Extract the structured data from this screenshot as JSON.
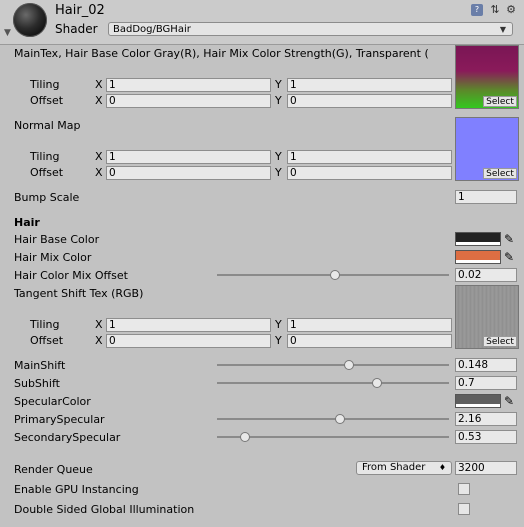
{
  "header": {
    "title": "Hair_02",
    "shader_label": "Shader",
    "shader_value": "BadDog/BGHair"
  },
  "maintex": {
    "label": "MainTex, Hair Base Color Gray(R), Hair Mix Color Strength(G), Transparent (",
    "tiling_label": "Tiling",
    "offset_label": "Offset",
    "tiling_x": "1",
    "tiling_y": "1",
    "offset_x": "0",
    "offset_y": "0",
    "select": "Select"
  },
  "normal": {
    "label": "Normal Map",
    "tiling_label": "Tiling",
    "offset_label": "Offset",
    "tiling_x": "1",
    "tiling_y": "1",
    "offset_x": "0",
    "offset_y": "0",
    "select": "Select"
  },
  "bump": {
    "label": "Bump Scale",
    "value": "1"
  },
  "hair": {
    "section_label": "Hair",
    "base_color_label": "Hair Base Color",
    "base_color": "#222222",
    "mix_color_label": "Hair Mix Color",
    "mix_color": "#dd6e43",
    "mix_offset_label": "Hair Color Mix Offset",
    "mix_offset_value": "0.02",
    "mix_offset_fraction": 0.51
  },
  "tangent": {
    "label": "Tangent Shift Tex (RGB)",
    "tiling_label": "Tiling",
    "offset_label": "Offset",
    "tiling_x": "1",
    "tiling_y": "1",
    "offset_x": "0",
    "offset_y": "0",
    "select": "Select"
  },
  "sliders": [
    {
      "label": "MainShift",
      "value": "0.148",
      "fraction": 0.57
    },
    {
      "label": "SubShift",
      "value": "0.7",
      "fraction": 0.69
    },
    {
      "label": "PrimarySpecular",
      "value": "2.16",
      "fraction": 0.53
    },
    {
      "label": "SecondarySpecular",
      "value": "0.53",
      "fraction": 0.12
    }
  ],
  "specular": {
    "label": "SpecularColor",
    "color": "#5e5e5e"
  },
  "render_queue": {
    "label": "Render Queue",
    "mode": "From Shader",
    "value": "3200"
  },
  "gpu_instancing": {
    "label": "Enable GPU Instancing"
  },
  "double_sided": {
    "label": "Double Sided Global Illumination"
  },
  "xy": {
    "x": "X",
    "y": "Y"
  }
}
